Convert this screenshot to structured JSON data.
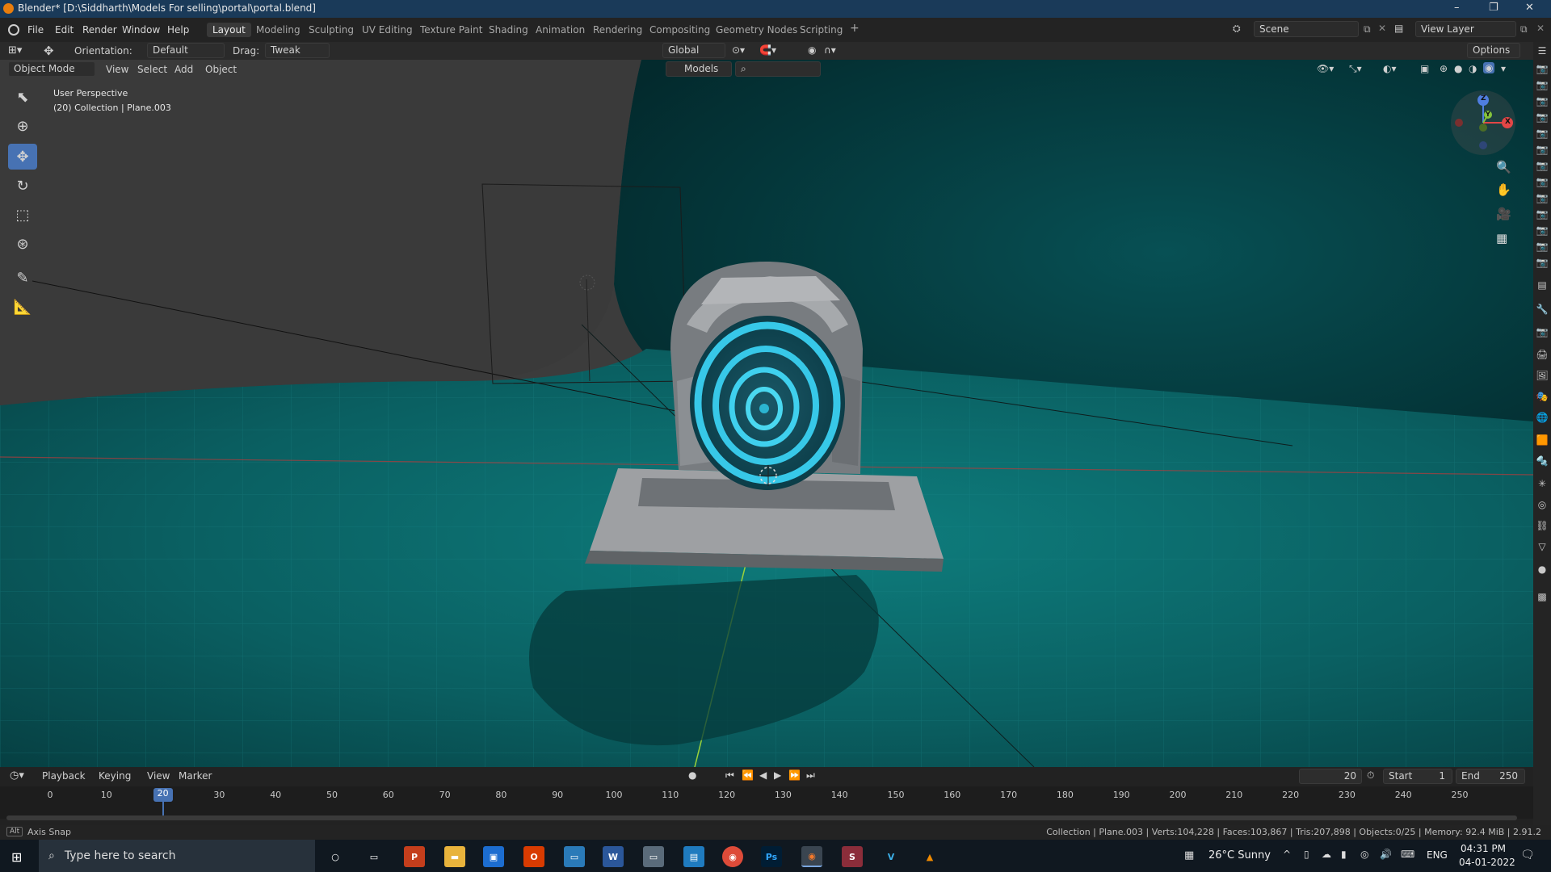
{
  "window": {
    "title": "Blender* [D:\\Siddharth\\Models For selling\\portal\\portal.blend]",
    "minimize": "–",
    "restore": "❐",
    "close": "✕"
  },
  "menu": {
    "items": [
      "File",
      "Edit",
      "Render",
      "Window",
      "Help"
    ]
  },
  "workspaces": [
    "Layout",
    "Modeling",
    "Sculpting",
    "UV Editing",
    "Texture Paint",
    "Shading",
    "Animation",
    "Rendering",
    "Compositing",
    "Geometry Nodes",
    "Scripting",
    "+"
  ],
  "scene": {
    "label": "Scene",
    "view_layer": "View Layer"
  },
  "header": {
    "orientation_label": "Orientation:",
    "orientation_value": "Default",
    "drag_label": "Drag:",
    "drag_value": "Tweak",
    "transform_space": "Global",
    "options": "Options"
  },
  "view3d_header": {
    "mode": "Object Mode",
    "menus": [
      "View",
      "Select",
      "Add",
      "Object"
    ],
    "collection_filter": "Models"
  },
  "viewport": {
    "perspective": "User Perspective",
    "context": "(20) Collection | Plane.003"
  },
  "gizmo": {
    "x": "X",
    "y": "Y",
    "z": "Z"
  },
  "timeline": {
    "menus": [
      "Playback",
      "Keying",
      "View",
      "Marker"
    ],
    "current_frame": "20",
    "start_label": "Start",
    "start": "1",
    "end_label": "End",
    "end": "250",
    "ticks": [
      "0",
      "10",
      "20",
      "30",
      "40",
      "50",
      "60",
      "70",
      "80",
      "90",
      "100",
      "110",
      "120",
      "130",
      "140",
      "150",
      "160",
      "170",
      "180",
      "190",
      "200",
      "210",
      "220",
      "230",
      "240",
      "250"
    ],
    "playhead": 20
  },
  "status": {
    "left": "Axis Snap",
    "left_key": "Alt",
    "right": "Collection | Plane.003 | Verts:104,228 | Faces:103,867 | Tris:207,898 | Objects:0/25 | Memory: 92.4 MiB | 2.91.2"
  },
  "taskbar": {
    "search_placeholder": "Type here to search",
    "apps": [
      "P",
      "📁",
      "🛍",
      "O",
      "🖥",
      "W",
      "📸",
      "📰",
      "⬤",
      "Ps",
      "B",
      "S",
      "V",
      "▲"
    ],
    "weather": "26°C  Sunny",
    "lang": "ENG",
    "time": "04:31 PM",
    "date": "04-01-2022"
  }
}
